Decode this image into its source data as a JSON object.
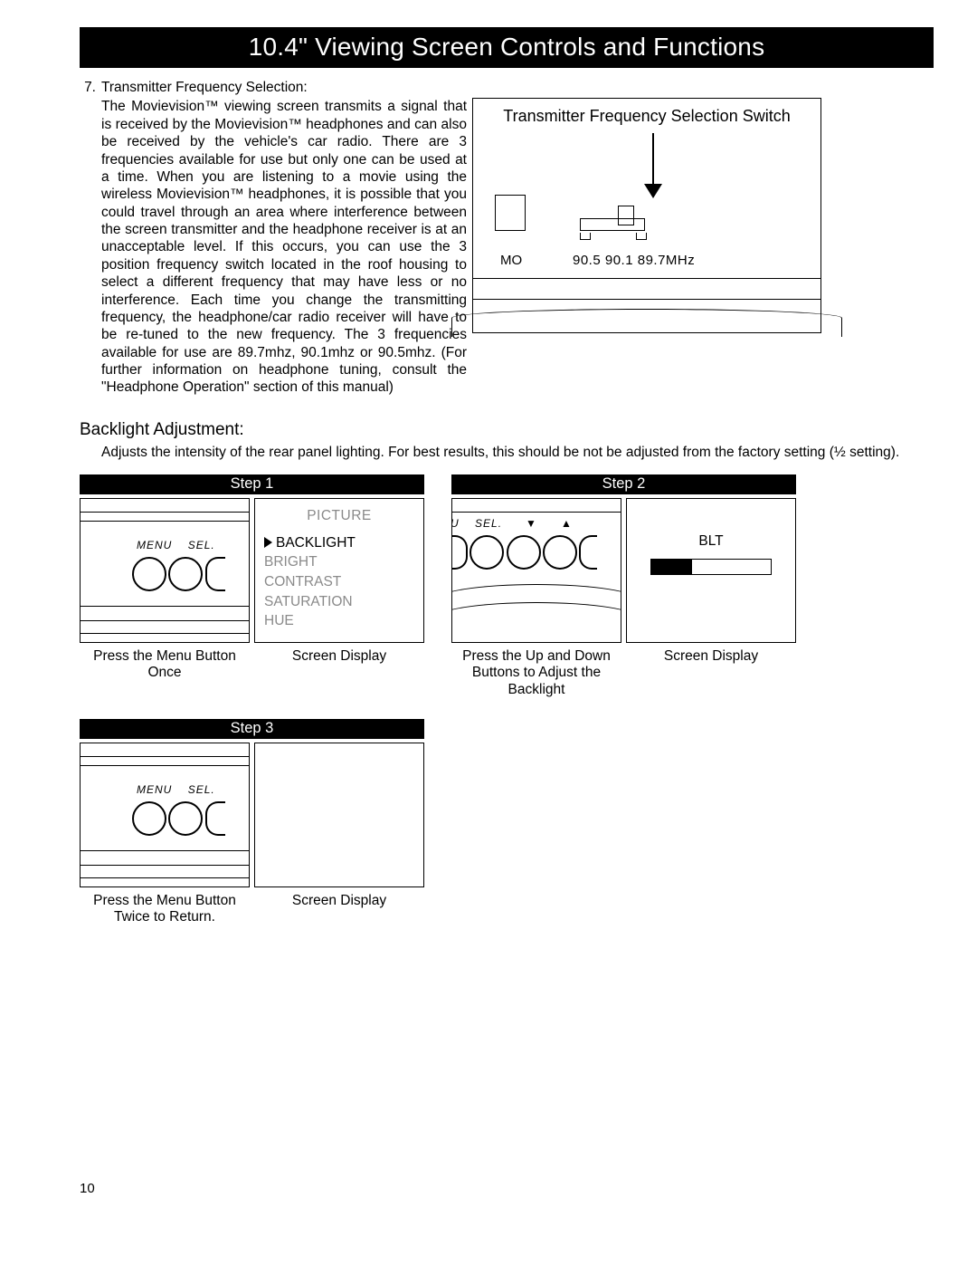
{
  "title": "10.4\" Viewing Screen Controls and Functions",
  "item7": {
    "num": "7.",
    "heading": "Transmitter Frequency Selection:",
    "body": "The Movievision™ viewing screen transmits a signal that is received by the Movievision™ headphones and can also be received by the vehicle's car radio. There are 3 frequencies available for use but only one can be used at a time. When you are listening to a movie using the wireless Movievision™ headphones, it is possible that you could travel through an area where interference between the screen transmitter and the headphone receiver is at an unacceptable level. If this occurs, you can use the 3 position frequency switch located in the roof housing to select a different frequency that may have less or no interference. Each time you change the transmitting frequency, the headphone/car radio receiver will have to be re-tuned to the new frequency. The 3 frequencies available for use are 89.7mhz, 90.1mhz or 90.5mhz. (For further information on headphone tuning, consult the \"Headphone Operation\" section of this manual)"
  },
  "freq_diagram": {
    "caption": "Transmitter Frequency Selection Switch",
    "mo": "MO",
    "freqs": "90.5  90.1  89.7MHz"
  },
  "backlight": {
    "heading": "Backlight Adjustment:",
    "desc": "Adjusts the intensity of the rear panel lighting. For best results, this should be not be adjusted from the factory setting (½ setting)."
  },
  "steps": {
    "s1": "Step 1",
    "s2": "Step 2",
    "s3": "Step 3"
  },
  "panel_labels": {
    "menu": "MENU",
    "sel": "SEL.",
    "u": "U",
    "down": "▼",
    "up": "▲"
  },
  "osd": {
    "title": "PICTURE",
    "items": [
      "BACKLIGHT",
      "BRIGHT",
      "CONTRAST",
      "SATURATION",
      "HUE"
    ],
    "blt": "BLT"
  },
  "captions": {
    "s1a": "Press the Menu Button Once",
    "s1b": "Screen Display",
    "s2a": "Press the Up and Down Buttons to Adjust the Backlight",
    "s2b": "Screen Display",
    "s3a": "Press the Menu Button Twice to Return.",
    "s3b": "Screen Display"
  },
  "page_number": "10"
}
